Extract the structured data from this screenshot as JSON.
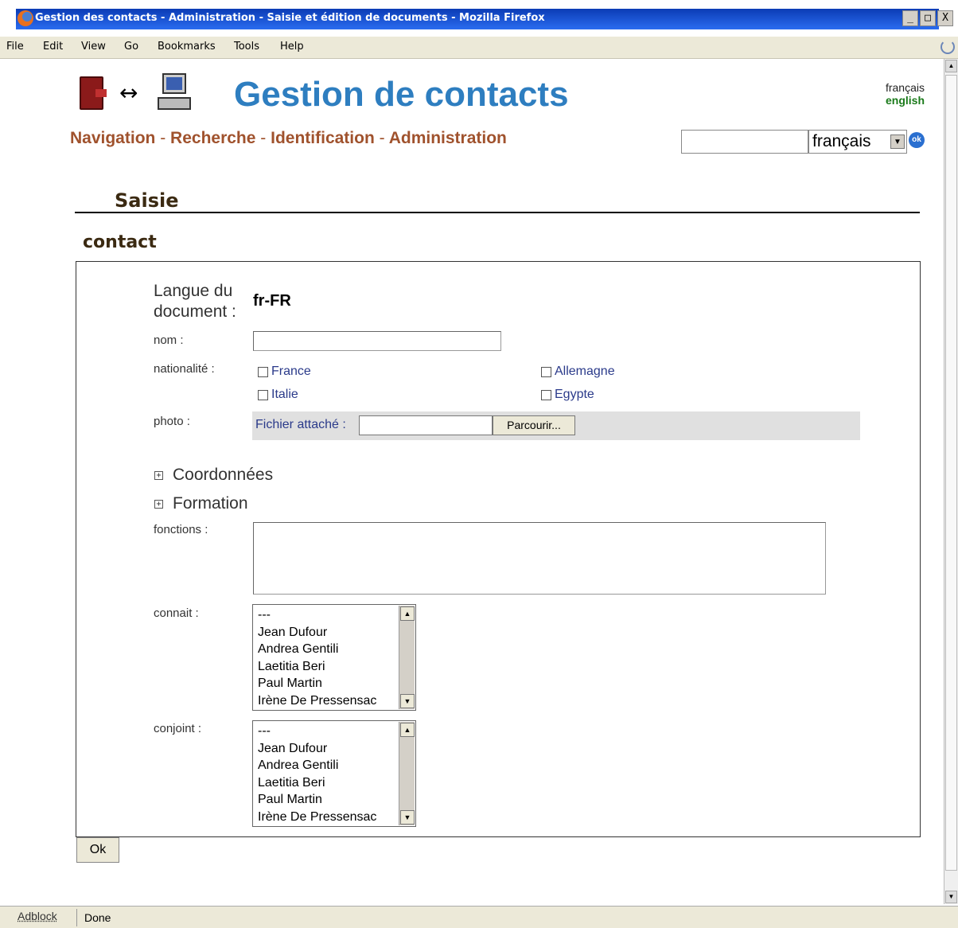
{
  "window": {
    "title": "Gestion des contacts - Administration - Saisie et édition de documents - Mozilla Firefox",
    "buttons": {
      "minimize": "_",
      "maximize": "□",
      "close": "X"
    }
  },
  "menu": {
    "items": [
      "File",
      "Edit",
      "View",
      "Go",
      "Bookmarks",
      "Tools",
      "Help"
    ]
  },
  "header": {
    "site_title": "Gestion de contacts",
    "lang_links": {
      "fr": "français",
      "en": "english"
    },
    "nav": [
      "Navigation",
      "Recherche",
      "Identification",
      "Administration"
    ],
    "nav_separator": "-",
    "search": {
      "value": "",
      "language": "français",
      "go_label": "ok"
    }
  },
  "page": {
    "section_title": "Saisie",
    "document_type": "contact"
  },
  "form": {
    "doc_language_label_line1": "Langue du",
    "doc_language_label_line2": "document :",
    "doc_language_value": "fr-FR",
    "nom_label": "nom :",
    "nom_value": "",
    "nationalite_label": "nationalité :",
    "nationalites": [
      "France",
      "Allemagne",
      "Italie",
      "Egypte"
    ],
    "photo_label": "photo :",
    "file_label": "Fichier attaché :",
    "browse_label": "Parcourir...",
    "coordonnees_label": "Coordonnées",
    "formation_label": "Formation",
    "fonctions_label": "fonctions :",
    "connait_label": "connait :",
    "conjoint_label": "conjoint :",
    "people_options": [
      "---",
      "Jean Dufour",
      "Andrea Gentili",
      "Laetitia Beri",
      "Paul Martin",
      "Irène De Pressensac"
    ],
    "submit_label": "Ok"
  },
  "statusbar": {
    "adblock": "Adblock",
    "status": "Done"
  },
  "colors": {
    "title_blue": "#2e7ec0",
    "nav_brown": "#a0522d",
    "english_green": "#1a7a1a",
    "checkbox_label_blue": "#2a3a8a"
  }
}
